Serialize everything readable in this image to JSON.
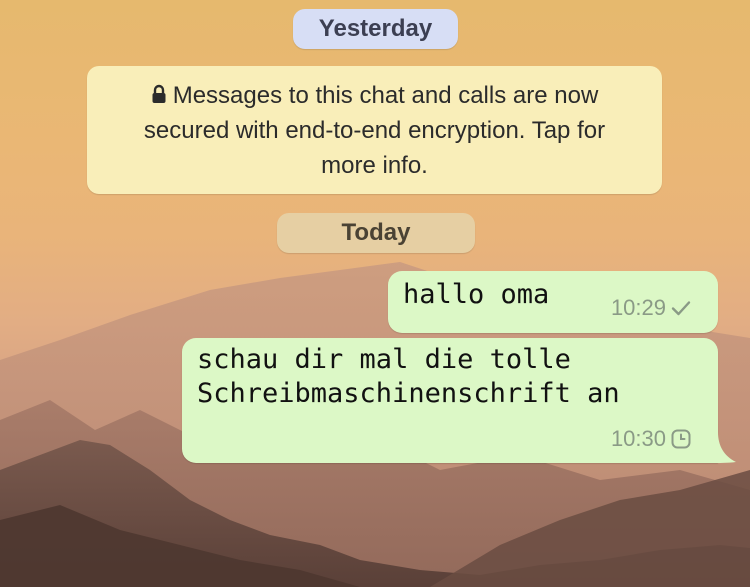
{
  "date_separators": {
    "yesterday": "Yesterday",
    "today": "Today"
  },
  "encryption_notice": {
    "line1": "Messages to this chat and calls are now",
    "line2": "secured with end-to-end encryption. Tap for",
    "line3": "more info.",
    "icon": "lock-icon"
  },
  "messages": [
    {
      "text": "hallo oma",
      "time": "10:29",
      "status_icon": "single-check-icon",
      "direction": "outgoing"
    },
    {
      "text_line1": "schau dir mal die tolle",
      "text_line2": "Schreibmaschinenschrift an",
      "time": "10:30",
      "status_icon": "clock-pending-icon",
      "direction": "outgoing"
    }
  ],
  "colors": {
    "outgoing_bubble": "#dcf8c6",
    "notice_bubble": "#f9eeb9",
    "yesterday_pill": "#d7def5",
    "today_pill": "#e6cfa3",
    "meta_text": "#8a9a86"
  }
}
